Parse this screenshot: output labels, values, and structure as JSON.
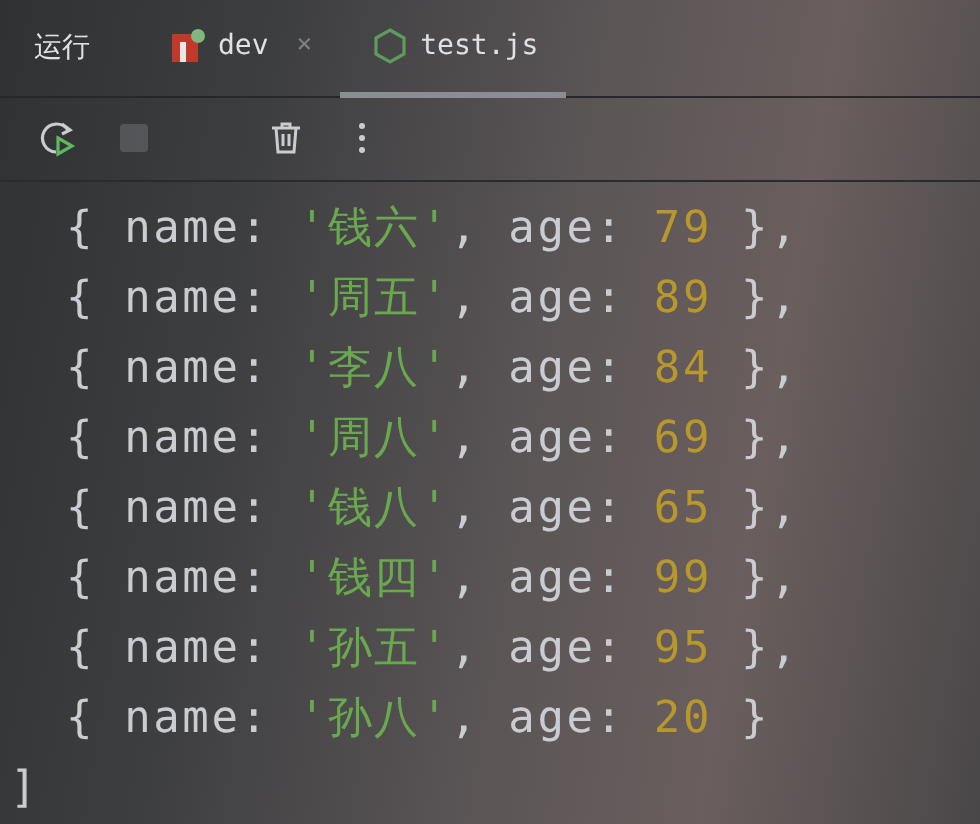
{
  "panel": {
    "title": "运行"
  },
  "tabs": [
    {
      "label": "dev",
      "kind": "package",
      "selected": false,
      "close": "×"
    },
    {
      "label": "test.js",
      "kind": "script",
      "selected": true
    }
  ],
  "toolbar": [
    {
      "kind": "rerun",
      "disabled": false
    },
    {
      "kind": "stop",
      "disabled": true
    },
    {
      "kind": "trash",
      "disabled": false
    },
    {
      "kind": "more",
      "disabled": false
    }
  ],
  "console": [
    {
      "tokens": [
        {
          "kind": "plain",
          "text": "{ name: "
        },
        {
          "kind": "string",
          "text": "'钱六'"
        },
        {
          "kind": "plain",
          "text": ", age: "
        },
        {
          "kind": "number",
          "text": "79"
        },
        {
          "kind": "plain",
          "text": " },"
        }
      ]
    },
    {
      "tokens": [
        {
          "kind": "plain",
          "text": "{ name: "
        },
        {
          "kind": "string",
          "text": "'周五'"
        },
        {
          "kind": "plain",
          "text": ", age: "
        },
        {
          "kind": "number",
          "text": "89"
        },
        {
          "kind": "plain",
          "text": " },"
        }
      ]
    },
    {
      "tokens": [
        {
          "kind": "plain",
          "text": "{ name: "
        },
        {
          "kind": "string",
          "text": "'李八'"
        },
        {
          "kind": "plain",
          "text": ", age: "
        },
        {
          "kind": "number",
          "text": "84"
        },
        {
          "kind": "plain",
          "text": " },"
        }
      ]
    },
    {
      "tokens": [
        {
          "kind": "plain",
          "text": "{ name: "
        },
        {
          "kind": "string",
          "text": "'周八'"
        },
        {
          "kind": "plain",
          "text": ", age: "
        },
        {
          "kind": "number",
          "text": "69"
        },
        {
          "kind": "plain",
          "text": " },"
        }
      ]
    },
    {
      "tokens": [
        {
          "kind": "plain",
          "text": "{ name: "
        },
        {
          "kind": "string",
          "text": "'钱八'"
        },
        {
          "kind": "plain",
          "text": ", age: "
        },
        {
          "kind": "number",
          "text": "65"
        },
        {
          "kind": "plain",
          "text": " },"
        }
      ]
    },
    {
      "tokens": [
        {
          "kind": "plain",
          "text": "{ name: "
        },
        {
          "kind": "string",
          "text": "'钱四'"
        },
        {
          "kind": "plain",
          "text": ", age: "
        },
        {
          "kind": "number",
          "text": "99"
        },
        {
          "kind": "plain",
          "text": " },"
        }
      ]
    },
    {
      "tokens": [
        {
          "kind": "plain",
          "text": "{ name: "
        },
        {
          "kind": "string",
          "text": "'孙五'"
        },
        {
          "kind": "plain",
          "text": ", age: "
        },
        {
          "kind": "number",
          "text": "95"
        },
        {
          "kind": "plain",
          "text": " },"
        }
      ]
    },
    {
      "tokens": [
        {
          "kind": "plain",
          "text": "{ name: "
        },
        {
          "kind": "string",
          "text": "'孙八'"
        },
        {
          "kind": "plain",
          "text": ", age: "
        },
        {
          "kind": "number",
          "text": "20"
        },
        {
          "kind": "plain",
          "text": " }"
        }
      ]
    },
    {
      "tokens": [
        {
          "kind": "plain",
          "text": "]"
        }
      ]
    }
  ]
}
